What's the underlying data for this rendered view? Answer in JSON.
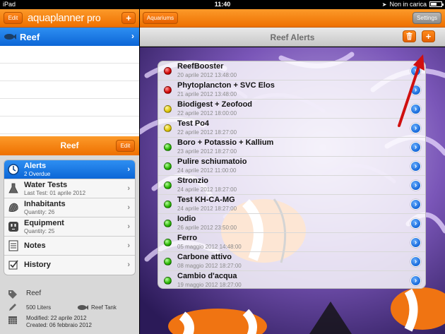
{
  "status_bar": {
    "device": "iPad",
    "time": "11:40",
    "charging": "Non in carica",
    "battery_level": 0.6
  },
  "left_top_bar": {
    "edit_label": "Edit",
    "logo_main": "aquaplanner",
    "logo_suffix": "pro",
    "add_label": "+"
  },
  "tanks": [
    {
      "name": "Reef",
      "icon": "fish-icon",
      "selected": true
    }
  ],
  "tank_panel": {
    "title": "Reef",
    "edit_label": "Edit",
    "menu": [
      {
        "title": "Alerts",
        "subtitle": "2 Overdue",
        "icon": "clock-icon",
        "active": true
      },
      {
        "title": "Water Tests",
        "subtitle": "Last Test: 01 aprile 2012",
        "icon": "flask-icon",
        "active": false
      },
      {
        "title": "Inhabitants",
        "subtitle": "Quantity: 26",
        "icon": "shell-icon",
        "active": false
      },
      {
        "title": "Equipment",
        "subtitle": "Quantity: 25",
        "icon": "plug-icon",
        "active": false
      },
      {
        "title": "Notes",
        "subtitle": "",
        "icon": "notepad-icon",
        "active": false
      },
      {
        "title": "History",
        "subtitle": "",
        "icon": "checkbox-icon",
        "active": false
      }
    ],
    "info": {
      "name": "Reef",
      "volume": "500 Liters",
      "type": "Reef Tank",
      "modified": "Modified: 22 aprile 2012",
      "created": "Created: 06 febbraio 2012"
    }
  },
  "right_top_bar": {
    "aquariums_label": "Aquariums",
    "settings_label": "Settings"
  },
  "alerts_panel": {
    "title": "Reef Alerts",
    "add_label": "+",
    "alerts": [
      {
        "title": "ReefBooster",
        "date": "20 aprile 2012 13:48:00",
        "status": "red"
      },
      {
        "title": "Phytoplancton + SVC Elos",
        "date": "21 aprile 2012 13:48:00",
        "status": "red"
      },
      {
        "title": "Biodigest + Zeofood",
        "date": "22 aprile 2012 18:00:00",
        "status": "yellow"
      },
      {
        "title": "Test Po4",
        "date": "22 aprile 2012 18:27:00",
        "status": "yellow"
      },
      {
        "title": "Boro + Potassio + Kallium",
        "date": "23 aprile 2012 18:27:00",
        "status": "green"
      },
      {
        "title": "Pulire schiumatoio",
        "date": "24 aprile 2012 11:00:00",
        "status": "green"
      },
      {
        "title": "Stronzio",
        "date": "24 aprile 2012 18:27:00",
        "status": "green"
      },
      {
        "title": "Test KH-CA-MG",
        "date": "24 aprile 2012 18:27:00",
        "status": "green"
      },
      {
        "title": "Iodio",
        "date": "26 aprile 2012 23:50:00",
        "status": "green"
      },
      {
        "title": "Ferro",
        "date": "05 maggio 2012 14:48:00",
        "status": "green"
      },
      {
        "title": "Carbone attivo",
        "date": "08 maggio 2012 18:27:00",
        "status": "green"
      },
      {
        "title": "Cambio d'acqua",
        "date": "19 maggio 2012 18:27:00",
        "status": "green"
      }
    ]
  },
  "colors": {
    "accent": "#f07a10",
    "selected": "#1a78e6",
    "red": "#d10000",
    "yellow": "#dcc400",
    "green": "#28b400",
    "arrow": "#d01010"
  }
}
